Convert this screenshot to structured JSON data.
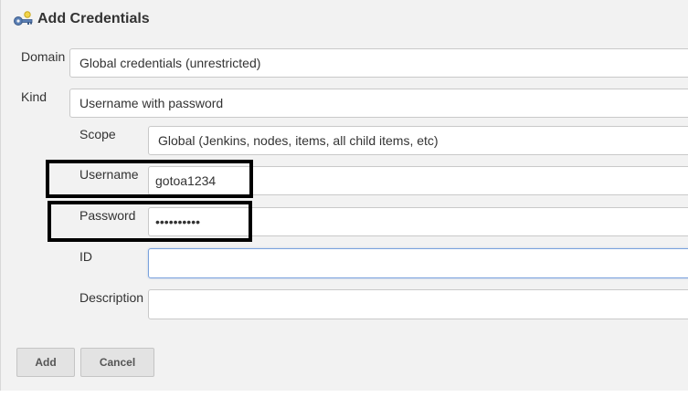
{
  "header": {
    "title": "Add Credentials",
    "icon": "credentials-key-icon"
  },
  "form": {
    "domain": {
      "label": "Domain",
      "value": "Global credentials (unrestricted)"
    },
    "kind": {
      "label": "Kind",
      "value": "Username with password"
    },
    "scope": {
      "label": "Scope",
      "value": "Global (Jenkins, nodes, items, all child items, etc)"
    },
    "username": {
      "label": "Username",
      "value": "gotoa1234"
    },
    "password": {
      "label": "Password",
      "value": "••••••••••"
    },
    "id": {
      "label": "ID",
      "value": ""
    },
    "description": {
      "label": "Description",
      "value": ""
    }
  },
  "buttons": {
    "add_label": "Add",
    "cancel_label": "Cancel"
  },
  "colors": {
    "panel_bg": "#f2f2f2",
    "highlight": "#000000",
    "focus_border": "#7aa2dd"
  }
}
